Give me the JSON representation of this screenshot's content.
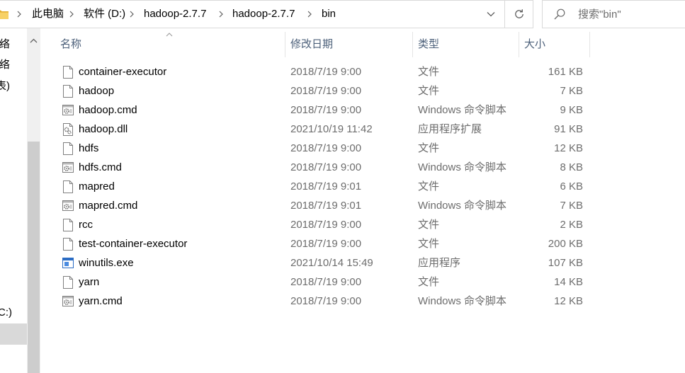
{
  "address_bar": {
    "location_icon": "folder-icon",
    "breadcrumb": [
      "此电脑",
      "软件 (D:)",
      "hadoop-2.7.7",
      "hadoop-2.7.7",
      "bin"
    ],
    "separator_icon": "chevron-right-icon",
    "history_dropdown_icon": "chevron-down-icon",
    "refresh_icon": "refresh-icon"
  },
  "search": {
    "icon": "search-icon",
    "placeholder": "搜索\"bin\""
  },
  "nav_pane": {
    "items": [
      "络",
      "络",
      "表)",
      "C:)"
    ],
    "scroll_up_icon": "chevron-up-icon"
  },
  "columns": [
    {
      "label": "名称",
      "sort_icon": "sort-ascending-icon"
    },
    {
      "label": "修改日期"
    },
    {
      "label": "类型"
    },
    {
      "label": "大小"
    }
  ],
  "files": [
    {
      "name": "container-executor",
      "modified": "2018/7/19 9:00",
      "type": "文件",
      "size": "161 KB",
      "icon": "file-icon"
    },
    {
      "name": "hadoop",
      "modified": "2018/7/19 9:00",
      "type": "文件",
      "size": "7 KB",
      "icon": "file-icon"
    },
    {
      "name": "hadoop.cmd",
      "modified": "2018/7/19 9:00",
      "type": "Windows 命令脚本",
      "size": "9 KB",
      "icon": "script-file-icon"
    },
    {
      "name": "hadoop.dll",
      "modified": "2021/10/19 11:42",
      "type": "应用程序扩展",
      "size": "91 KB",
      "icon": "dll-file-icon"
    },
    {
      "name": "hdfs",
      "modified": "2018/7/19 9:00",
      "type": "文件",
      "size": "12 KB",
      "icon": "file-icon"
    },
    {
      "name": "hdfs.cmd",
      "modified": "2018/7/19 9:00",
      "type": "Windows 命令脚本",
      "size": "8 KB",
      "icon": "script-file-icon"
    },
    {
      "name": "mapred",
      "modified": "2018/7/19 9:01",
      "type": "文件",
      "size": "6 KB",
      "icon": "file-icon"
    },
    {
      "name": "mapred.cmd",
      "modified": "2018/7/19 9:01",
      "type": "Windows 命令脚本",
      "size": "7 KB",
      "icon": "script-file-icon"
    },
    {
      "name": "rcc",
      "modified": "2018/7/19 9:00",
      "type": "文件",
      "size": "2 KB",
      "icon": "file-icon"
    },
    {
      "name": "test-container-executor",
      "modified": "2018/7/19 9:00",
      "type": "文件",
      "size": "200 KB",
      "icon": "file-icon"
    },
    {
      "name": "winutils.exe",
      "modified": "2021/10/14 15:49",
      "type": "应用程序",
      "size": "107 KB",
      "icon": "exe-file-icon"
    },
    {
      "name": "yarn",
      "modified": "2018/7/19 9:00",
      "type": "文件",
      "size": "14 KB",
      "icon": "file-icon"
    },
    {
      "name": "yarn.cmd",
      "modified": "2018/7/19 9:00",
      "type": "Windows 命令脚本",
      "size": "12 KB",
      "icon": "script-file-icon"
    }
  ],
  "colors": {
    "primary_text": "#000000",
    "secondary_text": "#6d6d6d",
    "header_text": "#4c607a",
    "border": "#d9d9d9",
    "nav_selection": "#d9d9d9",
    "scroll_track": "#f0f0f0",
    "scroll_thumb": "#cdcdcd",
    "header_divider": "#e5e5e5"
  }
}
